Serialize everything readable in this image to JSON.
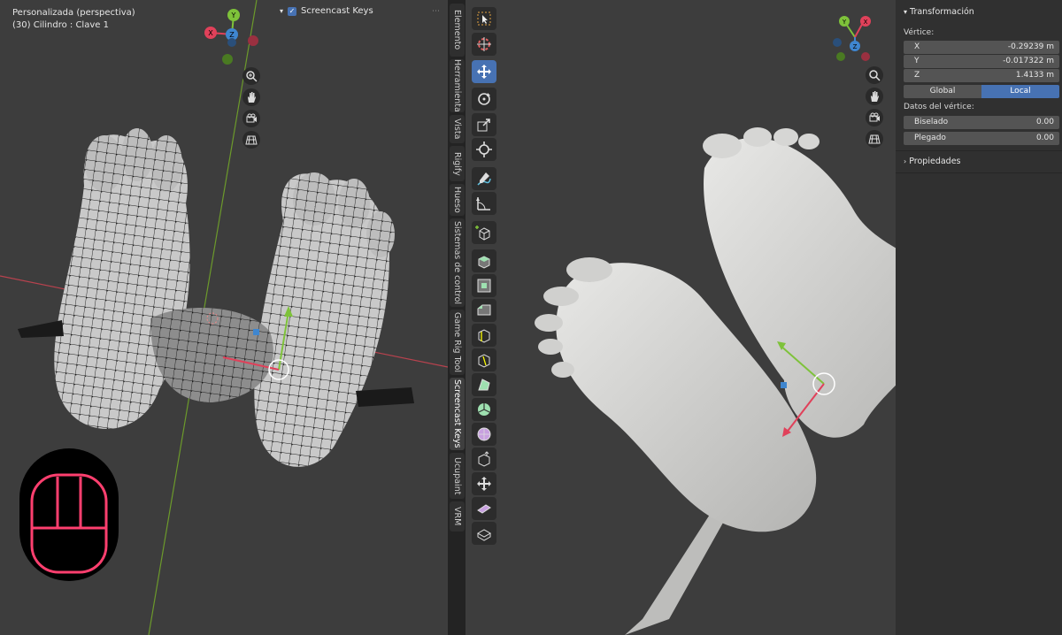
{
  "left_viewport": {
    "view_name": "Personalizada (perspectiva)",
    "object_info": "(30) Cilindro : Clave 1",
    "overlay_label": "Screencast Keys",
    "overlay_checked": true,
    "gizmo_axes": {
      "y": "Y",
      "x": "X",
      "z": "Z"
    }
  },
  "sidebar_tabs": [
    {
      "label": "Elemento"
    },
    {
      "label": "Herramienta"
    },
    {
      "label": "Vista"
    },
    {
      "label": "Rigify"
    },
    {
      "label": "Hueso"
    },
    {
      "label": "Sistemas de control"
    },
    {
      "label": "Game Rig Tool"
    },
    {
      "label": "Screencast Keys",
      "active": true
    },
    {
      "label": "Ucupaint"
    },
    {
      "label": "VRM"
    }
  ],
  "toolbar": {
    "tools": [
      "select-box",
      "cursor",
      "move",
      "rotate",
      "scale",
      "transform",
      "annotate",
      "measure",
      "add-cube",
      "extrude",
      "inset",
      "bevel",
      "loop-cut",
      "knife",
      "poly-build",
      "spin",
      "smooth",
      "shrink-fatten",
      "shear",
      "rip",
      "push-pull"
    ],
    "active_index": 2
  },
  "right_viewport": {
    "gizmo_axes": {
      "y": "Y",
      "x": "X",
      "z": "Z"
    }
  },
  "npanel": {
    "transform_title": "Transformación",
    "vertex_label": "Vértice:",
    "coords": [
      {
        "axis": "X",
        "value": "-0.29239 m"
      },
      {
        "axis": "Y",
        "value": "-0.017322 m"
      },
      {
        "axis": "Z",
        "value": "1.4133 m"
      }
    ],
    "space_toggle": {
      "global": "Global",
      "local": "Local",
      "selected": "Local"
    },
    "vertex_data_label": "Datos del vértice:",
    "vertex_data": [
      {
        "label": "Biselado",
        "value": "0.00"
      },
      {
        "label": "Plegado",
        "value": "0.00"
      }
    ],
    "properties_title": "Propiedades"
  },
  "colors": {
    "x_axis": "#e0415a",
    "y_axis": "#7ec23a",
    "z_axis": "#3f86cf",
    "active_tool": "#4772b3",
    "mouse_indicator": "#ff3f6f"
  }
}
